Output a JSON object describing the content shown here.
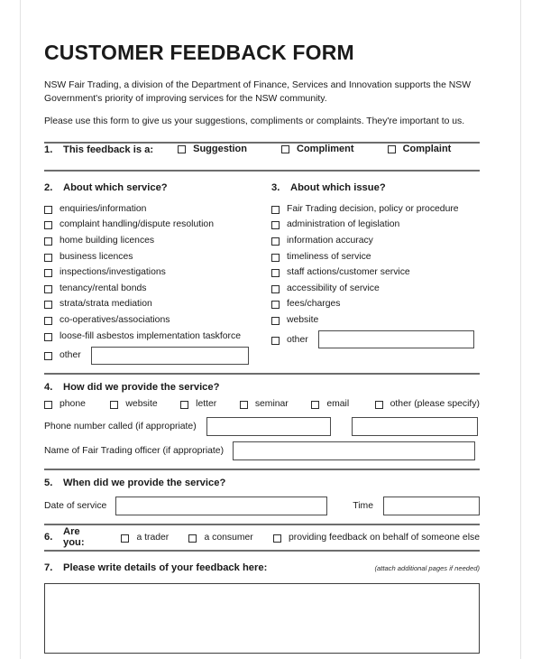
{
  "document": {
    "title": "CUSTOMER FEEDBACK FORM",
    "intro_paragraph_1": "NSW Fair Trading, a division of the Department of Finance, Services and Innovation supports the NSW Government's priority of improving services for the NSW community.",
    "intro_paragraph_2": "Please use this form to give us your suggestions, compliments or complaints. They're important to us."
  },
  "question1": {
    "number": "1.",
    "title": "This feedback is a:",
    "options": [
      {
        "label": "Suggestion"
      },
      {
        "label": "Compliment"
      },
      {
        "label": "Complaint"
      }
    ]
  },
  "question2": {
    "number": "2.",
    "title": "About which service?",
    "options": [
      {
        "label": "enquiries/information"
      },
      {
        "label": "complaint handling/dispute resolution"
      },
      {
        "label": "home building licences"
      },
      {
        "label": "business licences"
      },
      {
        "label": "inspections/investigations"
      },
      {
        "label": "tenancy/rental bonds"
      },
      {
        "label": "strata/strata mediation"
      },
      {
        "label": "co-operatives/associations"
      },
      {
        "label": "loose-fill asbestos implementation taskforce"
      }
    ],
    "other_label": "other",
    "other_value": ""
  },
  "question3": {
    "number": "3.",
    "title": "About which issue?",
    "options": [
      {
        "label": "Fair Trading decision, policy or procedure"
      },
      {
        "label": "administration of legislation"
      },
      {
        "label": "information accuracy"
      },
      {
        "label": "timeliness of service"
      },
      {
        "label": "staff actions/customer service"
      },
      {
        "label": "accessibility of service"
      },
      {
        "label": "fees/charges"
      },
      {
        "label": "website"
      }
    ],
    "other_label": "other",
    "other_value": ""
  },
  "question4": {
    "number": "4.",
    "title": "How did we provide the service?",
    "options": [
      {
        "label": "phone"
      },
      {
        "label": "website"
      },
      {
        "label": "letter"
      },
      {
        "label": "seminar"
      },
      {
        "label": "email"
      },
      {
        "label": "other (please specify)"
      }
    ],
    "phone_label": "Phone number called (if appropriate)",
    "phone_value": "",
    "other_specify_value": "",
    "officer_label": "Name of Fair Trading officer (if appropriate)",
    "officer_value": ""
  },
  "question5": {
    "number": "5.",
    "title": "When did we provide the service?",
    "date_label": "Date of service",
    "date_value": "",
    "time_label": "Time",
    "time_value": ""
  },
  "question6": {
    "number": "6.",
    "title": "Are you:",
    "options": [
      {
        "label": "a trader"
      },
      {
        "label": "a consumer"
      },
      {
        "label": "providing feedback on behalf of someone else"
      }
    ]
  },
  "question7": {
    "number": "7.",
    "title": "Please write details of your feedback here:",
    "note": "(attach additional pages if needed)",
    "value": ""
  }
}
